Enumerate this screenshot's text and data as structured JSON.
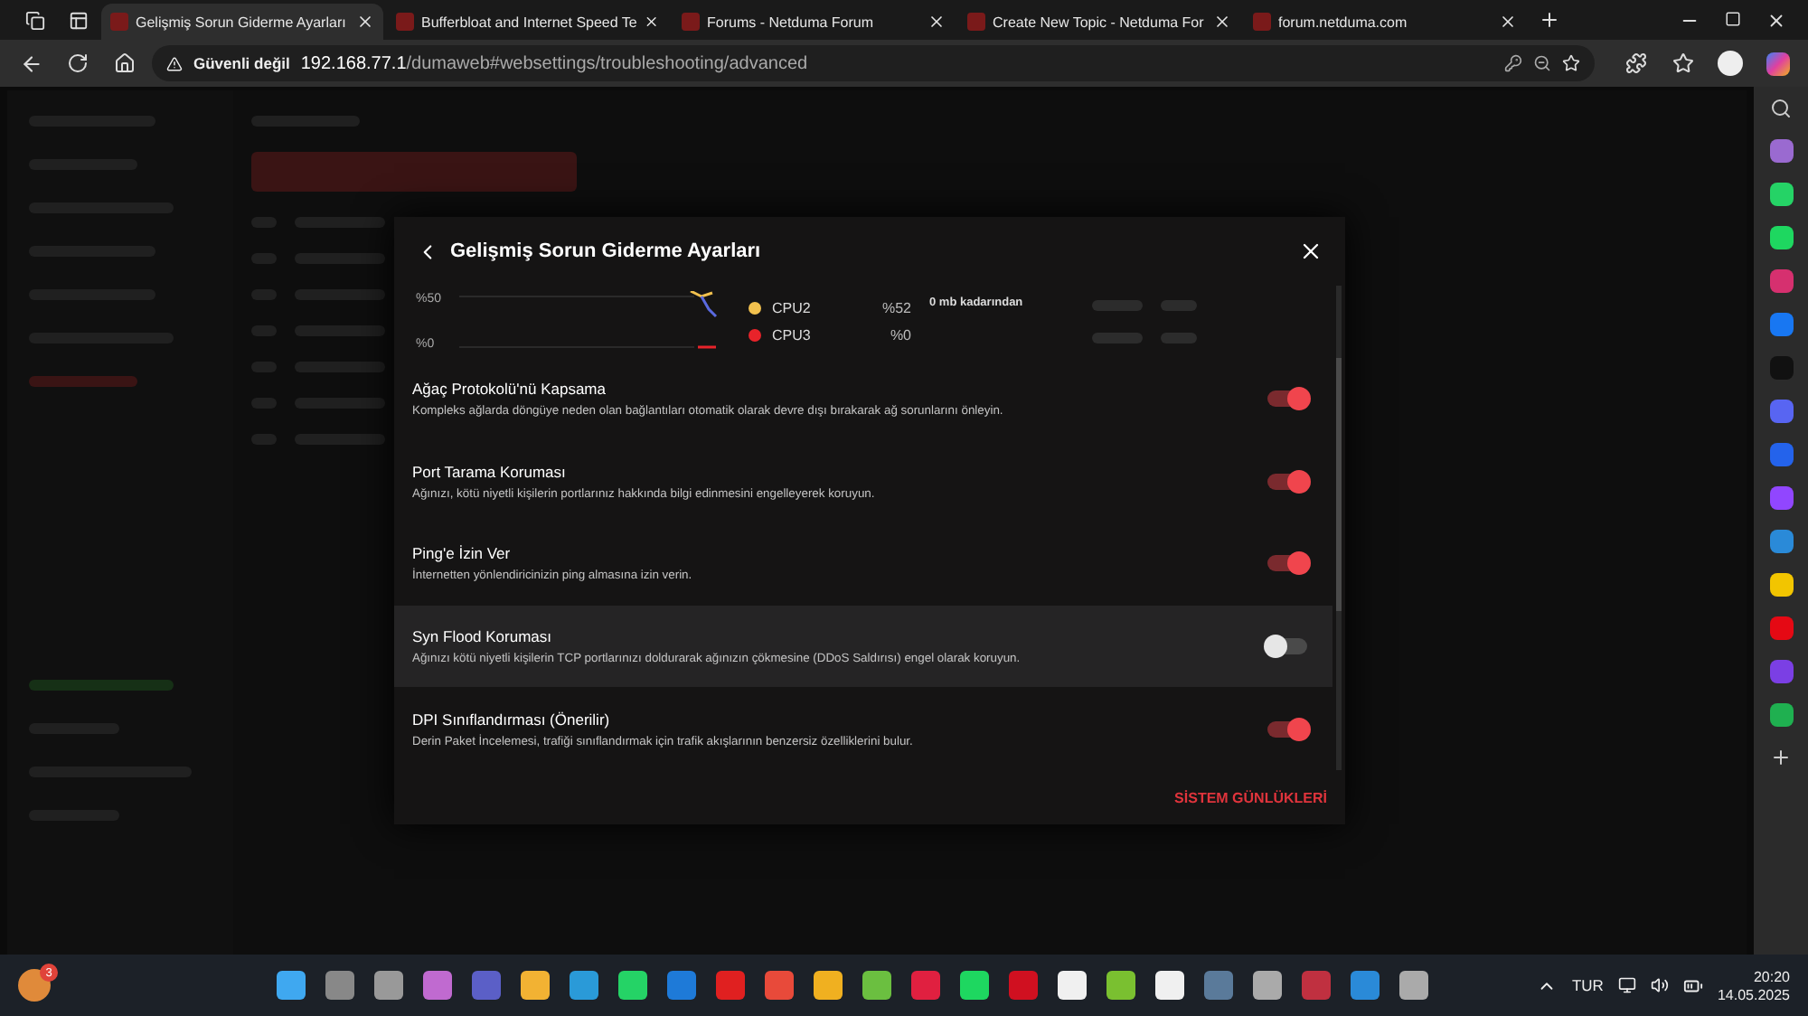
{
  "browser": {
    "tabs": [
      {
        "title": "Gelişmiş Sorun Giderme Ayarları",
        "selected": true
      },
      {
        "title": "Bufferbloat and Internet Speed Te",
        "selected": false
      },
      {
        "title": "Forums - Netduma Forum",
        "selected": false
      },
      {
        "title": "Create New Topic - Netduma For",
        "selected": false
      },
      {
        "title": "forum.netduma.com",
        "selected": false
      }
    ],
    "address": {
      "security": "Güvenli değil",
      "host": "192.168.77.1",
      "path": "/dumaweb#websettings/troubleshooting/advanced"
    }
  },
  "modal": {
    "title": "Gelişmiş Sorun Giderme Ayarları",
    "chart": {
      "y_labels": [
        "%50",
        "%0"
      ],
      "legend": [
        {
          "label": "CPU2",
          "value": "%52",
          "color": "#f2c14e"
        },
        {
          "label": "CPU3",
          "value": "%0",
          "color": "#e8232a"
        }
      ],
      "note": "0 mb kadarından"
    },
    "settings": [
      {
        "title": "Ağaç Protokolü'nü Kapsama",
        "description": "Kompleks ağlarda döngüye neden olan bağlantıları otomatik olarak devre dışı bırakarak ağ sorunlarını önleyin.",
        "on": true,
        "hovered": false
      },
      {
        "title": "Port Tarama Koruması",
        "description": "Ağınızı, kötü niyetli kişilerin portlarınız hakkında bilgi edinmesini engelleyerek koruyun.",
        "on": true,
        "hovered": false
      },
      {
        "title": "Ping'e İzin Ver",
        "description": "İnternetten yönlendiricinizin ping almasına izin verin.",
        "on": true,
        "hovered": false
      },
      {
        "title": "Syn Flood Koruması",
        "description": "Ağınızı kötü niyetli kişilerin TCP portlarınızı doldurarak ağınızın çökmesine (DDoS Saldırısı) engel olarak koruyun.",
        "on": false,
        "hovered": true
      },
      {
        "title": "DPI Sınıflandırması (Önerilir)",
        "description": "Derin Paket İncelemesi, trafiği sınıflandırmak için trafik akışlarının benzersiz özelliklerini bulur.",
        "on": true,
        "hovered": false
      }
    ],
    "footer_link": "SİSTEM GÜNLÜKLERİ"
  },
  "taskbar": {
    "notification_count": "3",
    "language": "TUR",
    "time": "20:20",
    "date": "14.05.2025"
  }
}
